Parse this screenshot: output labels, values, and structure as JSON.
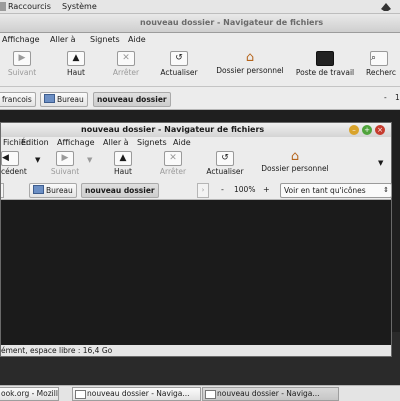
{
  "panel": {
    "items": [
      "Raccourcis",
      "Système"
    ]
  },
  "back_window": {
    "title": "nouveau dossier - Navigateur de fichiers",
    "menu": [
      "Affichage",
      "Aller à",
      "Signets",
      "Aide"
    ],
    "toolbar": [
      "Suivant",
      "Haut",
      "Arrêter",
      "Actualiser",
      "Dossier personnel",
      "Poste de travail",
      "Recherc"
    ],
    "breadcrumbs": [
      "francois",
      "Bureau",
      "nouveau dossier"
    ],
    "zoom_partial": "1"
  },
  "front_window": {
    "title": "nouveau dossier - Navigateur de fichiers",
    "menu": [
      "Fichier",
      "Édition",
      "Affichage",
      "Aller à",
      "Signets",
      "Aide"
    ],
    "toolbar": [
      "cédent",
      "Suivant",
      "Haut",
      "Arrêter",
      "Actualiser",
      "Dossier personnel"
    ],
    "breadcrumbs": [
      "Bureau",
      "nouveau dossier"
    ],
    "zoom": "100%",
    "zoom_minus": "-",
    "zoom_plus": "+",
    "view_mode": "Voir en tant qu'icônes",
    "status": "ément, espace libre : 16,4 Go"
  },
  "taskbar": {
    "items": [
      "ook.org - Mozill...",
      "nouveau dossier - Naviga...",
      "nouveau dossier - Naviga..."
    ]
  }
}
